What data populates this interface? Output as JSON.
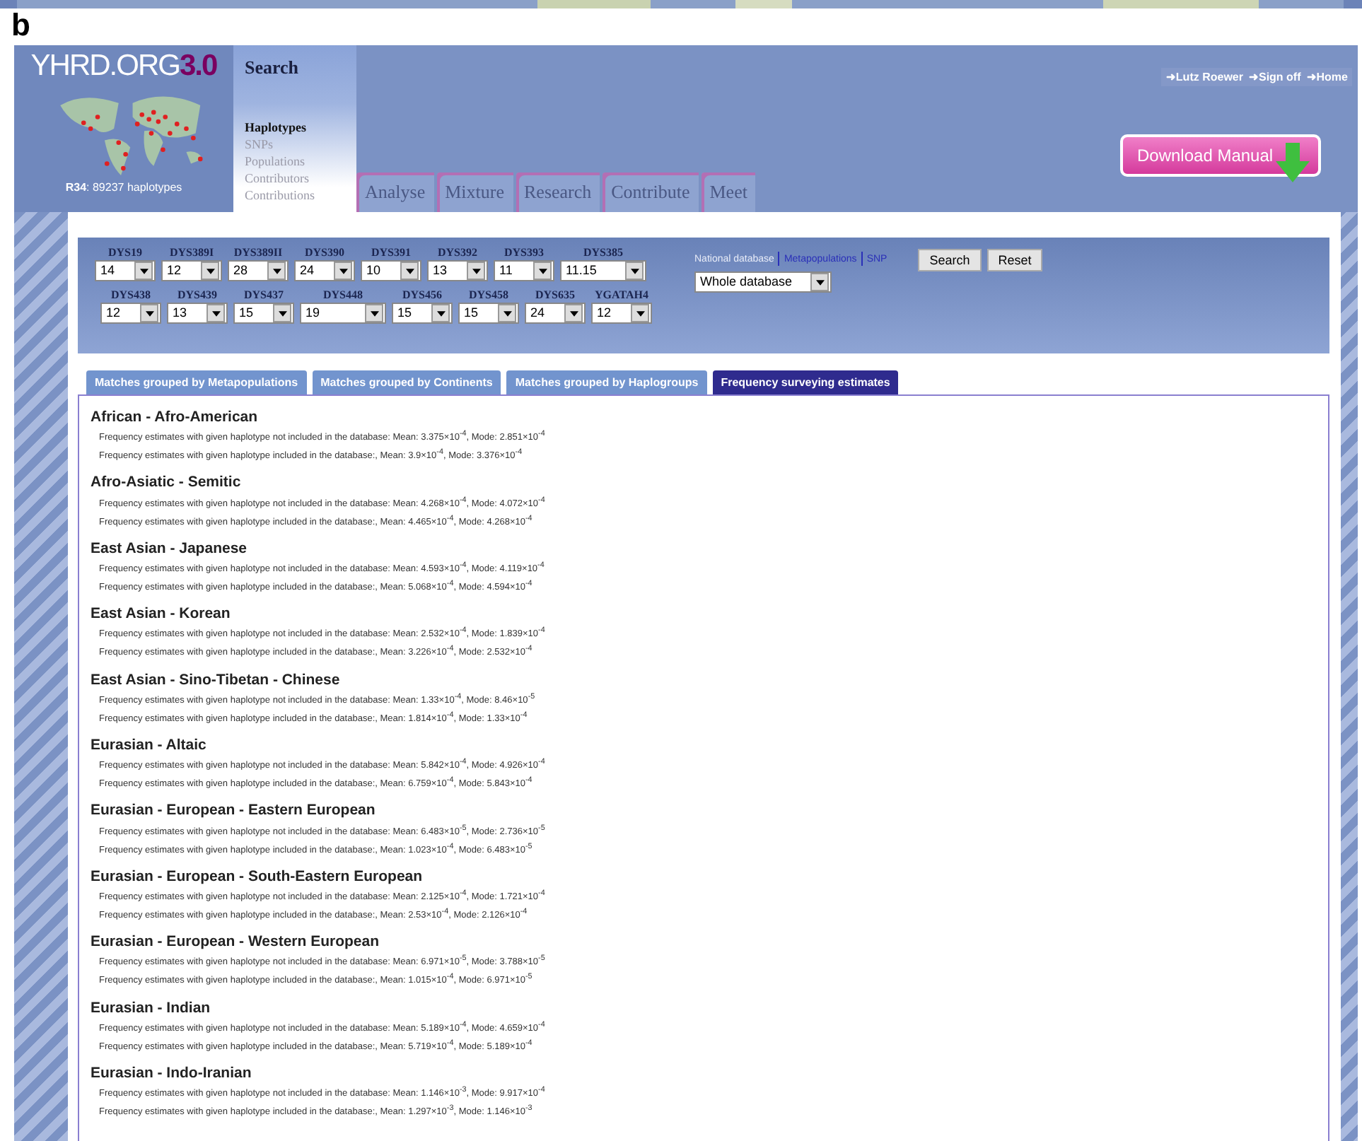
{
  "panel_label": "b",
  "header": {
    "logo": {
      "name": "YHRD.ORG",
      "version": "3.0",
      "stats": "**R34**: 89237 haplotypes"
    },
    "search_menu": {
      "title": "Search",
      "items": [
        {
          "label": "Haplotypes",
          "selected": true
        },
        {
          "label": "SNPs",
          "selected": false
        },
        {
          "label": "Populations",
          "selected": false
        },
        {
          "label": "Contributors",
          "selected": false
        },
        {
          "label": "Contributions",
          "selected": false
        }
      ]
    },
    "tabs": [
      "Analyse",
      "Mixture",
      "Research",
      "Contribute",
      "Meet"
    ],
    "user_links": [
      "➜Lutz Roewer",
      "➜Sign off",
      "➜Home"
    ],
    "download_button": "Download Manual"
  },
  "search_form": {
    "rows": [
      [
        {
          "marker": "DYS19",
          "value": "14"
        },
        {
          "marker": "DYS389I",
          "value": "12"
        },
        {
          "marker": "DYS389II",
          "value": "28"
        },
        {
          "marker": "DYS390",
          "value": "24"
        },
        {
          "marker": "DYS391",
          "value": "10"
        },
        {
          "marker": "DYS392",
          "value": "13"
        },
        {
          "marker": "DYS393",
          "value": "11"
        },
        {
          "marker": "DYS385",
          "value": "11.15"
        }
      ],
      [
        {
          "marker": "DYS438",
          "value": "12"
        },
        {
          "marker": "DYS439",
          "value": "13"
        },
        {
          "marker": "DYS437",
          "value": "15"
        },
        {
          "marker": "DYS448",
          "value": "19"
        },
        {
          "marker": "DYS456",
          "value": "15"
        },
        {
          "marker": "DYS458",
          "value": "15"
        },
        {
          "marker": "DYS635",
          "value": "24"
        },
        {
          "marker": "YGATAH4",
          "value": "12"
        }
      ]
    ],
    "database_links": [
      {
        "label": "National database",
        "selected": true
      },
      {
        "label": "Metapopulations",
        "selected": false
      },
      {
        "label": "SNP",
        "selected": false
      }
    ],
    "database_select": "Whole database",
    "buttons": [
      "Search",
      "Reset"
    ]
  },
  "result_tabs": [
    {
      "label": "Matches grouped by Metapopulations",
      "selected": false
    },
    {
      "label": "Matches grouped by Continents",
      "selected": false
    },
    {
      "label": "Matches grouped by Haplogroups",
      "selected": false
    },
    {
      "label": "Frequency surveying estimates",
      "selected": true
    }
  ],
  "results": [
    {
      "population": "African - Afro-American",
      "lines": [
        "Frequency estimates with given haplotype not included in the database: Mean: 3.375×10$^{-4}$, Mode: 2.851×10$^{-4}$",
        "Frequency estimates with given haplotype included in the database:, Mean: 3.9×10$^{-4}$, Mode: 3.376×10$^{-4}$"
      ]
    },
    {
      "population": "Afro-Asiatic - Semitic",
      "lines": [
        "Frequency estimates with given haplotype not included in the database: Mean: 4.268×10$^{-4}$, Mode: 4.072×10$^{-4}$",
        "Frequency estimates with given haplotype included in the database:, Mean: 4.465×10$^{-4}$, Mode: 4.268×10$^{-4}$"
      ]
    },
    {
      "population": "East Asian - Japanese",
      "lines": [
        "Frequency estimates with given haplotype not included in the database: Mean: 4.593×10$^{-4}$, Mode: 4.119×10$^{-4}$",
        "Frequency estimates with given haplotype included in the database:, Mean: 5.068×10$^{-4}$, Mode: 4.594×10$^{-4}$"
      ]
    },
    {
      "population": "East Asian - Korean",
      "lines": [
        "Frequency estimates with given haplotype not included in the database: Mean: 2.532×10$^{-4}$, Mode: 1.839×10$^{-4}$",
        "Frequency estimates with given haplotype included in the database:, Mean: 3.226×10$^{-4}$, Mode: 2.532×10$^{-4}$"
      ]
    },
    {
      "population": "East Asian - Sino-Tibetan - Chinese",
      "lines": [
        "Frequency estimates with given haplotype not included in the database: Mean: 1.33×10$^{-4}$, Mode: 8.46×10$^{-5}$",
        "Frequency estimates with given haplotype included in the database:, Mean: 1.814×10$^{-4}$, Mode: 1.33×10$^{-4}$"
      ]
    },
    {
      "population": "Eurasian - Altaic",
      "lines": [
        "Frequency estimates with given haplotype not included in the database: Mean: 5.842×10$^{-4}$, Mode: 4.926×10$^{-4}$",
        "Frequency estimates with given haplotype included in the database:, Mean: 6.759×10$^{-4}$, Mode: 5.843×10$^{-4}$"
      ]
    },
    {
      "population": "Eurasian - European - Eastern European",
      "lines": [
        "Frequency estimates with given haplotype not included in the database: Mean: 6.483×10$^{-5}$, Mode: 2.736×10$^{-5}$",
        "Frequency estimates with given haplotype included in the database:, Mean: 1.023×10$^{-4}$, Mode: 6.483×10$^{-5}$"
      ]
    },
    {
      "population": "Eurasian - European - South-Eastern European",
      "lines": [
        "Frequency estimates with given haplotype not included in the database: Mean: 2.125×10$^{-4}$, Mode: 1.721×10$^{-4}$",
        "Frequency estimates with given haplotype included in the database:, Mean: 2.53×10$^{-4}$, Mode: 2.126×10$^{-4}$"
      ]
    },
    {
      "population": "Eurasian - European - Western European",
      "lines": [
        "Frequency estimates with given haplotype not included in the database: Mean: 6.971×10$^{-5}$, Mode: 3.788×10$^{-5}$",
        "Frequency estimates with given haplotype included in the database:, Mean: 1.015×10$^{-4}$, Mode: 6.971×10$^{-5}$"
      ]
    },
    {
      "population": "Eurasian - Indian",
      "lines": [
        "Frequency estimates with given haplotype not included in the database: Mean: 5.189×10$^{-4}$, Mode: 4.659×10$^{-4}$",
        "Frequency estimates with given haplotype included in the database:, Mean: 5.719×10$^{-4}$, Mode: 5.189×10$^{-4}$"
      ]
    },
    {
      "population": "Eurasian - Indo-Iranian",
      "lines": [
        "Frequency estimates with given haplotype not included in the database: Mean: 1.146×10$^{-3}$, Mode: 9.917×10$^{-4}$",
        "Frequency estimates with given haplotype included in the database:, Mean: 1.297×10$^{-3}$, Mode: 1.146×10$^{-3}$"
      ]
    }
  ]
}
